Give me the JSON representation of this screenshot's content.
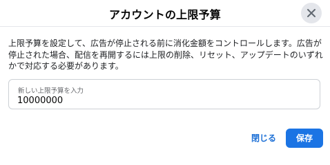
{
  "dialog": {
    "title": "アカウントの上限予算",
    "close_icon": "close-icon",
    "description": "上限予算を設定して、広告が停止される前に消化金額をコントロールします。広告が停止された場合、配信を再開するには上限の削除、リセット、アップデートのいずれかで対応する必要があります。",
    "budget_field": {
      "label": "新しい上限予算を入力",
      "value": "10000000"
    },
    "buttons": {
      "close_label": "閉じる",
      "save_label": "保存"
    }
  },
  "colors": {
    "primary": "#1b74e4",
    "link": "#1b6fd6",
    "close_button_bg": "#e4e6eb",
    "border": "#ccd0d5"
  }
}
